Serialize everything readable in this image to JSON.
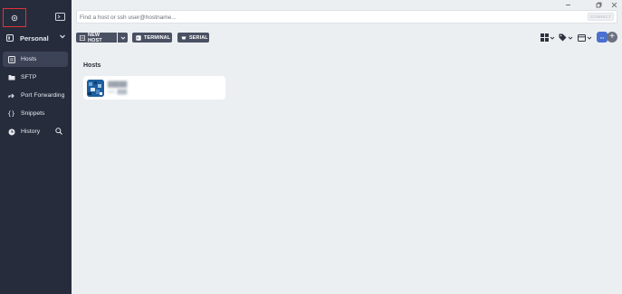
{
  "sidebar": {
    "vault": {
      "label": "Personal"
    },
    "items": [
      {
        "label": "Hosts",
        "icon": "hosts-icon",
        "active": true
      },
      {
        "label": "SFTP",
        "icon": "folder-icon",
        "active": false
      },
      {
        "label": "Port Forwarding",
        "icon": "arrow-icon",
        "active": false
      },
      {
        "label": "Snippets",
        "icon": "braces-icon",
        "active": false
      },
      {
        "label": "History",
        "icon": "clock-icon",
        "active": false
      }
    ]
  },
  "search": {
    "placeholder": "Find a host or ssh user@hostname...",
    "connect_label": "CONNECT"
  },
  "toolbar": {
    "new_host_label": "NEW HOST",
    "terminal_label": "TERMINAL",
    "serial_label": "SERIAL"
  },
  "main": {
    "section_title": "Hosts",
    "hosts": [
      {
        "name": "█████",
        "subtitle": "ssh, ███"
      }
    ]
  },
  "user": {
    "avatar_text": "•••"
  },
  "colors": {
    "sidebar_bg": "#262c3c",
    "content_bg": "#eceff1",
    "button_bg": "#4a5163",
    "highlight_border": "#e0323a"
  }
}
